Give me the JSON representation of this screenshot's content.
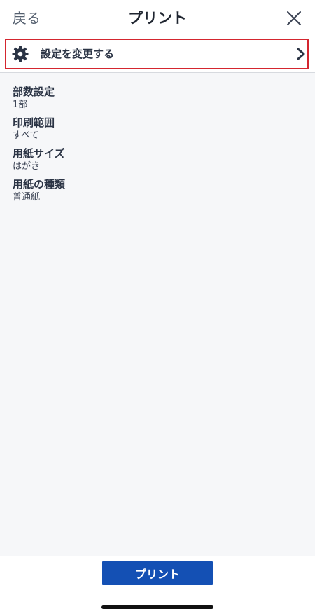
{
  "header": {
    "back_label": "戻る",
    "title": "プリント",
    "close_icon": "close-icon"
  },
  "settings_row": {
    "label": "設定を変更する",
    "icon": "gear-icon",
    "chevron_icon": "chevron-right-icon",
    "highlight_color": "#d4262f"
  },
  "summary": {
    "items": [
      {
        "label": "部数設定",
        "value": "1部"
      },
      {
        "label": "印刷範囲",
        "value": "すべて"
      },
      {
        "label": "用紙サイズ",
        "value": "はがき"
      },
      {
        "label": "用紙の種類",
        "value": "普通紙"
      }
    ]
  },
  "footer": {
    "print_label": "プリント",
    "button_color": "#1450b4"
  }
}
